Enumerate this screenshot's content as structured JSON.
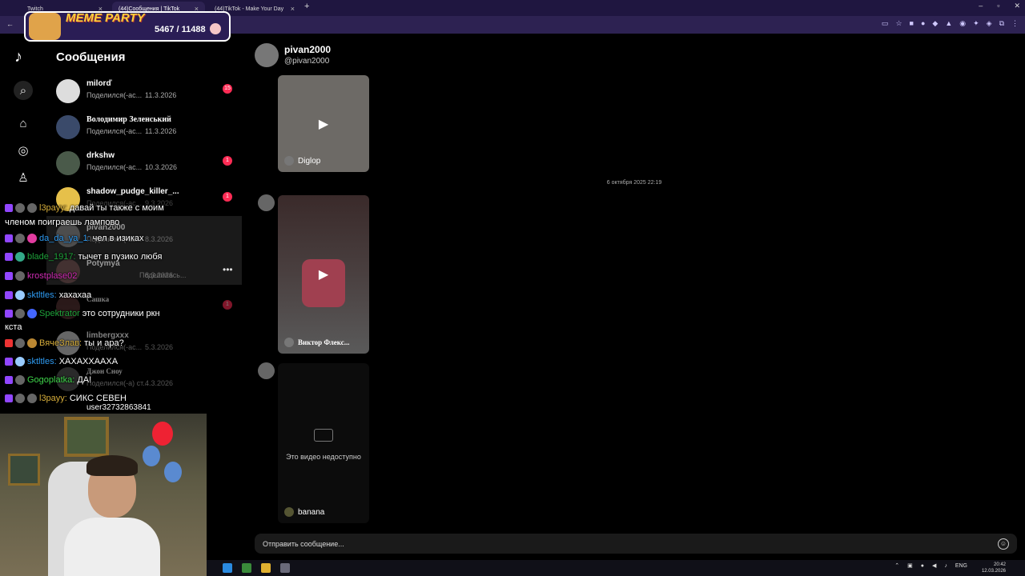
{
  "browser": {
    "tabs": [
      {
        "label": "Twitch"
      },
      {
        "label": "(44)Сообщения | TikTok"
      },
      {
        "label": "(44)TikTok - Make Your Day"
      }
    ],
    "new_tab": "+"
  },
  "overlay": {
    "title": "MEME PARTY",
    "count": "5467 / 11488"
  },
  "sidebar": {
    "title": "Сообщения",
    "conversations": [
      {
        "name": "milorď",
        "preview": "Поделился(-ас...",
        "date": "11.3.2026",
        "badge": "15"
      },
      {
        "name": "Володимир Зеленський",
        "preview": "Поделился(-ас...",
        "date": "11.3.2026",
        "badge": ""
      },
      {
        "name": "drkshw",
        "preview": "Поделился(-ас...",
        "date": "10.3.2026",
        "badge": "1"
      },
      {
        "name": "shadow_pudge_killer_...",
        "preview": "Поделился(-ас...",
        "date": "9.3.2026",
        "badge": "1"
      },
      {
        "name": "pivan2000",
        "preview": "Поделился(-ас...",
        "date": "8.3.2026",
        "badge": ""
      },
      {
        "name": "Potymya",
        "preview": "Поделилась...",
        "date": "8.3.2026",
        "badge": ""
      },
      {
        "name": "Сашка",
        "preview": "",
        "date": "",
        "badge": "1"
      },
      {
        "name": "limbergxxx",
        "preview": "Поделился(-ас...",
        "date": "5.3.2026",
        "badge": ""
      },
      {
        "name": "Джон Сноу",
        "preview": "Поделился(-а) ст...",
        "date": "4.3.2026",
        "badge": ""
      },
      {
        "name": "user32732863841",
        "preview": "",
        "date": "",
        "badge": ""
      }
    ]
  },
  "chat": [
    {
      "user": "l3payy:",
      "text": "давай ты также с моим",
      "color": "#d6ad3a"
    },
    {
      "user": "",
      "text": "членом поиграешь лампово",
      "color": "#ffffff"
    },
    {
      "user": "da_da_ya_1:",
      "text": "чел в изиках",
      "color": "#2e9bf2"
    },
    {
      "user": "blade_1917:",
      "text": "тычет в пузико любя",
      "color": "#1ea13a"
    },
    {
      "user": "krostplase02",
      "text": "",
      "color": "#d22db6"
    },
    {
      "user": "sktltles:",
      "text": "хахахаа",
      "color": "#2e9bf2"
    },
    {
      "user": "Spektrator",
      "text": "это сотрудники ркн",
      "color": "#1ea13a"
    },
    {
      "user": "",
      "text": "кста",
      "color": "#ffffff"
    },
    {
      "user": "ВячеЗлав:",
      "text": "ты и ара?",
      "color": "#d6ad3a"
    },
    {
      "user": "sktltles:",
      "text": "ХАХАХХААХА",
      "color": "#2e9bf2"
    },
    {
      "user": "Gogoplatka:",
      "text": "ДА!",
      "color": "#3fd64b"
    },
    {
      "user": "l3payy:",
      "text": "СИКС СЕВЕН",
      "color": "#d6ad3a"
    }
  ],
  "conversation": {
    "name": "pivan2000",
    "handle": "@pivan2000",
    "date_separator": "6 октября 2025 22:19",
    "videos": [
      {
        "caption": "Diglop"
      },
      {
        "caption": "Виктор Флекс..."
      },
      {
        "caption": "banana"
      }
    ],
    "unavailable_text": "Это видео недоступно",
    "input_placeholder": "Отправить сообщение..."
  },
  "taskbar": {
    "lang": "ENG",
    "time": "20:42",
    "date": "12.03.2026"
  }
}
